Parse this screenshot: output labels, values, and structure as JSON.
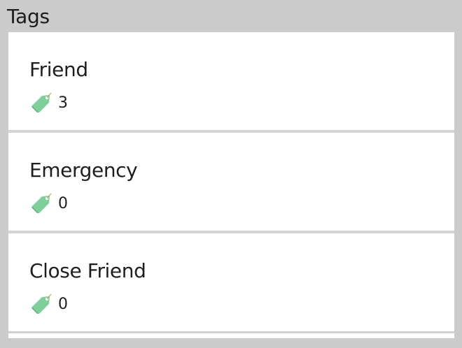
{
  "panel": {
    "title": "Tags"
  },
  "tags": [
    {
      "name": "Friend",
      "count": "3",
      "icon": "tag-icon"
    },
    {
      "name": "Emergency",
      "count": "0",
      "icon": "tag-icon"
    },
    {
      "name": "Close Friend",
      "count": "0",
      "icon": "tag-icon"
    }
  ],
  "colors": {
    "background": "#cbcbcb",
    "card": "#ffffff",
    "tag_icon": "#7fcf9c",
    "text": "#1e1e1e"
  }
}
